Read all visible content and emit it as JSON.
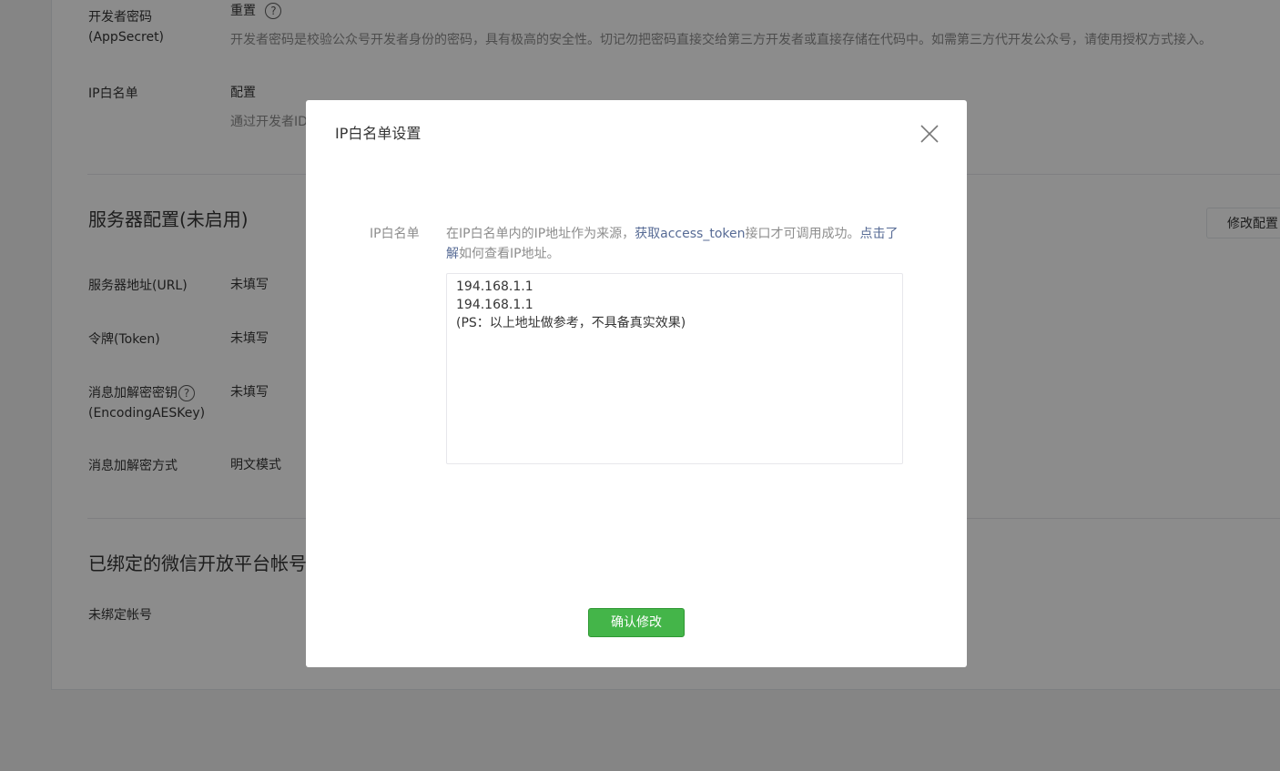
{
  "background_page": {
    "app_secret": {
      "label_line1": "开发者密码",
      "label_line2": "(AppSecret)",
      "action": "重置",
      "help": "?",
      "description": "开发者密码是校验公众号开发者身份的密码，具有极高的安全性。切记勿把密码直接交给第三方开发者或直接存储在代码中。如需第三方代开发公众号，请使用授权方式接入。"
    },
    "ip_whitelist": {
      "label": "IP白名单",
      "action": "配置",
      "description": "通过开发者ID"
    },
    "server_config": {
      "title": "服务器配置(未启用)",
      "edit_button": "修改配置",
      "rows": [
        {
          "label": "服务器地址(URL)",
          "value": "未填写"
        },
        {
          "label": "令牌(Token)",
          "value": "未填写"
        },
        {
          "label_line1": "消息加解密密钥",
          "label_line2": "(EncodingAESKey)",
          "help": "?",
          "value": "未填写"
        },
        {
          "label": "消息加解密方式",
          "value": "明文模式"
        }
      ]
    },
    "open_platform": {
      "title": "已绑定的微信开放平台帐号",
      "status": "未绑定帐号"
    }
  },
  "dialog": {
    "title": "IP白名单设置",
    "close_icon": "close-icon",
    "form_label": "IP白名单",
    "tips": {
      "text1": "在IP白名单内的IP地址作为来源，",
      "link1": "获取access_token",
      "text2": "接口才可调用成功。",
      "link2": "点击了解",
      "text3": "如何查看IP地址。"
    },
    "ip_list_value": "194.168.1.1\n194.168.1.1\n(PS：以上地址做参考，不具备真实效果)",
    "confirm_button": "确认修改"
  },
  "colors": {
    "primary_green": "#44b549",
    "link_blue": "#576b95",
    "mask": "rgba(0,0,0,0.45)"
  }
}
